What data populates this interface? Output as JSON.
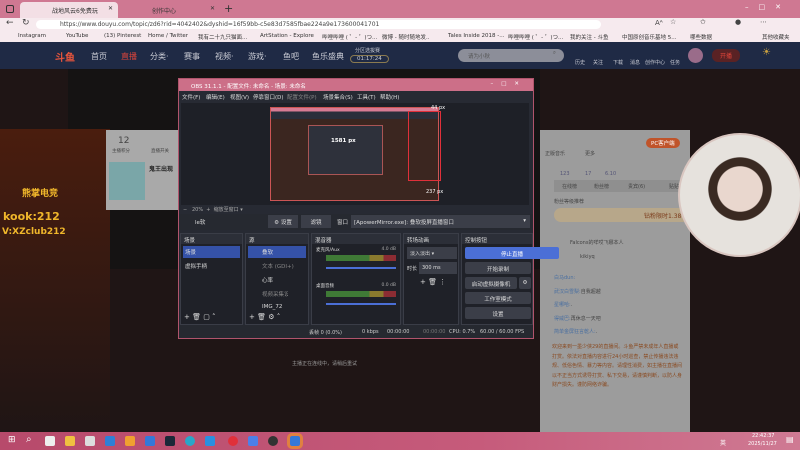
{
  "browser": {
    "tabs": [
      {
        "label": "战地风云6免费玩"
      },
      {
        "label": "创作中心"
      }
    ],
    "url": "https://www.douyu.com/topic/zd6?rid=4042402&dyshid=16f59bb-c5e83d7585fbae224a9e173600041701",
    "bookmarks": [
      "Instagram",
      "YouTube",
      "(13) Pinterest",
      "Home / Twitter",
      "我有二十九只猫面...",
      "ArtStation - Explore",
      "哔哩哔哩 ( ゜- ゜)つ...",
      "微博 - 随时随地发...",
      "Tales Inside 2018 -...",
      "哔哩哔哩 ( ゜- ゜)つ...",
      "我的关注 - 斗鱼",
      "中国原创音乐基地 5...",
      "哪些数据",
      "其他收藏夹"
    ]
  },
  "douyu": {
    "logo": "斗鱼",
    "nav": [
      "首页",
      "直播",
      "分类·",
      "赛事",
      "视频·",
      "游戏·",
      "鱼吧",
      "鱼乐盛典"
    ],
    "countdown_label": "分区选拔赛",
    "countdown": "01:17:24",
    "search_placeholder": "请为小秋",
    "icons": [
      "历史",
      "关注",
      "下载",
      "消息",
      "创作中心",
      "任务"
    ],
    "live_btn": "开播",
    "score": "12",
    "score_label": "主播积分",
    "switch_label": "直播开关",
    "card_title": "鬼王出现",
    "overlay_brand": "熊掌电竞",
    "overlay_line1": "kook:212",
    "overlay_line2": "V:XZclub212",
    "offline_msg": "主播正在连线中，请稍后重试",
    "side": {
      "music": "正版音乐",
      "more": "更多",
      "pc_btn": "PC客户端",
      "stats": [
        "123",
        "17",
        "6.10"
      ],
      "tabs": [
        "在线榜",
        "粉丝榜",
        "贵宾(6)",
        "贴贴"
      ],
      "fans_label": "粉丝等级推荐",
      "banner": "钻粉限时1.38",
      "rank": [
        {
          "name": "Falcons的咩哎飞娜本人"
        },
        {
          "name": "kikiyq"
        }
      ],
      "chat": [
        {
          "user": "白马dun:"
        },
        {
          "user": "武汉白雪梨:",
          "text": "自我超越"
        },
        {
          "user": "星哪哈:",
          "text": "."
        },
        {
          "user": "得威巴:",
          "text": "再休息一天吧"
        },
        {
          "user": "简单金屏狂言乾人:",
          "text": "."
        }
      ],
      "notice": "欢迎来到一墨少侠29的直播间。斗鱼严禁未成年人直播或打赏。依法对直播内容进行24小时巡查，禁止传播违法违规、低俗色情、暴力等内容。请理性消费，如主播在直播间以不正当方式诱导打赏、私下交易，请谨慎判断，以防人身财产损失。谨防网络诈骗。"
    }
  },
  "obs": {
    "title": "OBS 31.1.1 - 配置文件: 未命名 - 场景: 未命名",
    "menu": [
      "文件(F)",
      "编辑(E)",
      "视图(V)",
      "停靠窗口(D)",
      "配置文件(P)",
      "场景集合(S)",
      "工具(T)",
      "帮助(H)"
    ],
    "preview_label1": "1581 px",
    "preview_label2": "237 px",
    "preview_label3": "44 px",
    "zoom": "20%",
    "zoom_mode": "缩放至窗口",
    "source_name": "le软",
    "settings_btn": "设置",
    "filters_btn": "滤镜",
    "window_label": "窗口",
    "window_value": "[ApowerMirror.exe]: 叠软投屏直播窗口",
    "docks": {
      "scenes": "场景",
      "sources": "源",
      "mixer": "混音器",
      "transitions": "转场动画",
      "controls": "控制按钮"
    },
    "scenes": [
      "场景",
      "虚拟手柄"
    ],
    "sources": [
      "叠软",
      "文本 (GDI+)",
      "心率",
      "视频采集设备",
      "IMG_72"
    ],
    "mixer": [
      {
        "name": "麦克风/Aux",
        "db": "4.0 dB"
      },
      {
        "name": "桌面音频",
        "db": "0.0 dB"
      }
    ],
    "transition": "淡入淡出",
    "duration_label": "时长",
    "duration": "300 ms",
    "controls": [
      "停止直播",
      "开始录制",
      "启动虚拟摄像机",
      "工作室模式",
      "设置"
    ],
    "status": {
      "dropped": "丢帧 0 (0.0%)",
      "bitrate": "0 kbps",
      "live_time": "00:00:00",
      "rec_time": "00:00:00",
      "cpu": "CPU: 0.7%",
      "fps": "60.00 / 60.00 FPS"
    }
  },
  "taskbar": {
    "time": "22:42:37",
    "date": "2025/11/27",
    "ime": "英"
  },
  "colors": {
    "accent": "#4b6fd6",
    "tab": "#cf7892",
    "douyu_nav": "#1f2a45"
  }
}
